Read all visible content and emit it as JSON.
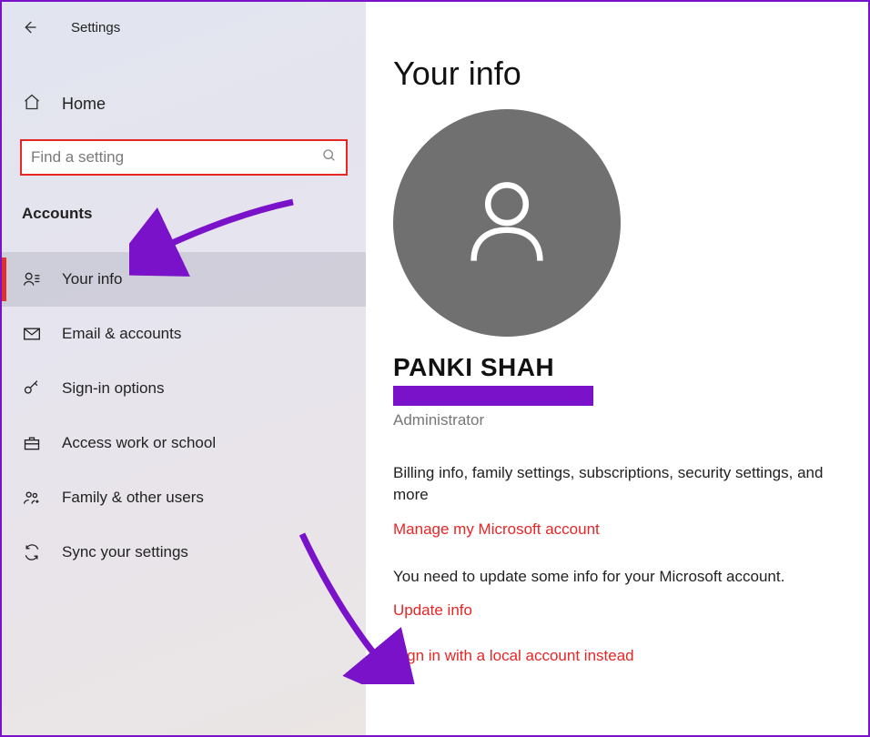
{
  "window": {
    "title": "Settings"
  },
  "sidebar": {
    "home_label": "Home",
    "search_placeholder": "Find a setting",
    "section_label": "Accounts",
    "items": [
      {
        "label": "Your info"
      },
      {
        "label": "Email & accounts"
      },
      {
        "label": "Sign-in options"
      },
      {
        "label": "Access work or school"
      },
      {
        "label": "Family & other users"
      },
      {
        "label": "Sync your settings"
      }
    ]
  },
  "content": {
    "page_title": "Your info",
    "user_name": "PANKI SHAH",
    "role": "Administrator",
    "desc1": "Billing info, family settings, subscriptions, security settings, and more",
    "link_manage": "Manage my Microsoft account",
    "desc2": "You need to update some info for your Microsoft account.",
    "link_update": "Update info",
    "link_local": "Sign in with a local account instead"
  }
}
